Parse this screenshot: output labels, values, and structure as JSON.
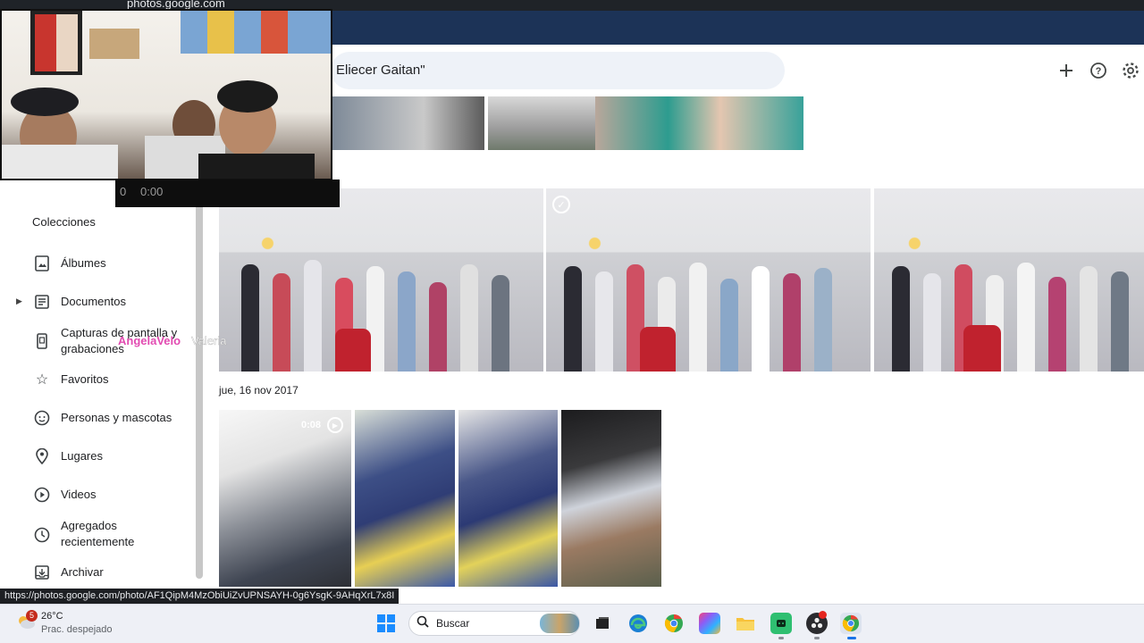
{
  "browser": {
    "url": "photos.google.com"
  },
  "header": {
    "search_text": "Eliecer Gaitan\"",
    "create_icon": "plus-icon",
    "help_icon": "help-icon",
    "settings_icon": "gear-icon"
  },
  "webcam": {
    "counter": "0",
    "time": "0:00"
  },
  "overlay": {
    "name_1": "AngelaVelo",
    "name_2": "Valeria"
  },
  "sidebar": {
    "heading": "Colecciones",
    "items": [
      {
        "label": "Álbumes",
        "icon": "album-icon"
      },
      {
        "label": "Documentos",
        "icon": "document-icon"
      },
      {
        "label": "Capturas de pantalla y grabaciones",
        "icon": "phone-screenshot-icon"
      },
      {
        "label": "Favoritos",
        "icon": "star-icon"
      },
      {
        "label": "Personas y mascotas",
        "icon": "face-icon"
      },
      {
        "label": "Lugares",
        "icon": "location-pin-icon"
      },
      {
        "label": "Videos",
        "icon": "play-circle-icon"
      },
      {
        "label": "Agregados recientemente",
        "icon": "clock-icon"
      },
      {
        "label": "Archivar",
        "icon": "archive-icon"
      }
    ]
  },
  "main": {
    "date_label": "jue, 16 nov 2017",
    "video_duration": "0:08"
  },
  "status_link": "https://photos.google.com/photo/AF1QipM4MzObiUiZvUPNSAYH-0g6YsgK-9AHqXrL7x8I",
  "taskbar": {
    "weather_badge": "5",
    "weather_temp": "26°C",
    "weather_desc": "Prac. despejado",
    "search_placeholder": "Buscar"
  }
}
